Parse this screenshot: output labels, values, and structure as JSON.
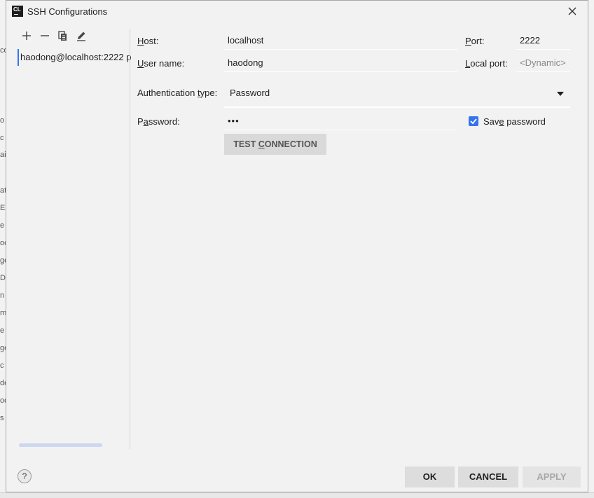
{
  "window": {
    "title": "SSH Configurations",
    "app_icon_text": "CL"
  },
  "toolbar": {
    "icons": [
      "plus-icon",
      "minus-icon",
      "copy-icon",
      "edit-icon"
    ]
  },
  "configurations": [
    {
      "label": "haodong@localhost:2222 p"
    }
  ],
  "form": {
    "host_label": "Host:",
    "host_value": "localhost",
    "port_label": "Port:",
    "port_value": "2222",
    "username_label": "User name:",
    "username_value": "haodong",
    "local_port_label": "Local port:",
    "local_port_placeholder": "<Dynamic>",
    "auth_label": "Authentication type:",
    "auth_value": "Password",
    "password_label": "Password:",
    "password_value": "•••",
    "save_password_label": "Save password",
    "save_password_checked": true,
    "test_connection_label": "TEST CONNECTION"
  },
  "footer": {
    "help_label": "?",
    "ok_label": "OK",
    "cancel_label": "CANCEL",
    "apply_label": "APPLY"
  },
  "background_fragments": [
    "co",
    "o",
    "c",
    "ai",
    "at",
    "E",
    "e",
    "oc",
    "ge",
    "D",
    "n",
    "m",
    "e",
    "ge",
    "c",
    "de",
    "od",
    "s"
  ],
  "colors": {
    "accent": "#3574f0",
    "background": "#f2f2f2"
  }
}
